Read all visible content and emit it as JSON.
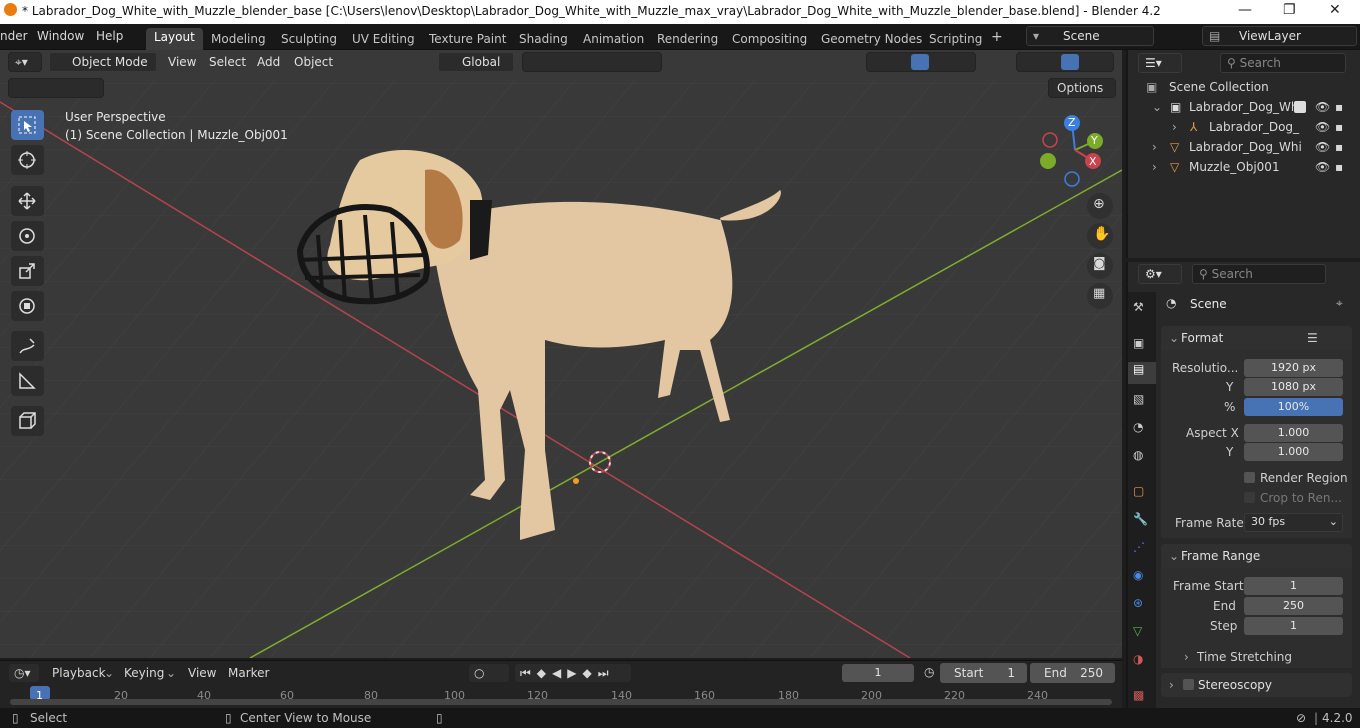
{
  "titlebar": {
    "title": "* Labrador_Dog_White_with_Muzzle_blender_base [C:\\Users\\lenov\\Desktop\\Labrador_Dog_White_with_Muzzle_max_vray\\Labrador_Dog_White_with_Muzzle_blender_base.blend] - Blender 4.2",
    "minimize": "—",
    "maximize": "❐",
    "close": "✕"
  },
  "menubar": {
    "items": [
      "nder",
      "Window",
      "Help"
    ]
  },
  "workspaces": {
    "tabs": [
      "Layout",
      "Modeling",
      "Sculpting",
      "UV Editing",
      "Texture Paint",
      "Shading",
      "Animation",
      "Rendering",
      "Compositing",
      "Geometry Nodes",
      "Scripting"
    ],
    "add": "+",
    "scene": "Scene",
    "view_layer": "ViewLayer"
  },
  "viewport_header": {
    "mode": "Object Mode",
    "menus": [
      "View",
      "Select",
      "Add",
      "Object"
    ],
    "orientation": "Global",
    "options": "Options"
  },
  "viewport": {
    "perspective": "User Perspective",
    "collection": "(1) Scene Collection | Muzzle_Obj001",
    "gizmo_labels": {
      "z": "Z",
      "y": "Y",
      "x": "X"
    },
    "colors": {
      "x_axis": "#c8434e",
      "y_axis": "#7cab2a",
      "z_axis": "#3b7fe0",
      "grid_bg": "#3a3a3a",
      "dog": "#e0c4a0",
      "muzzle": "#1a1a1a"
    }
  },
  "outliner": {
    "search_placeholder": "Search",
    "rows": [
      {
        "label": "Scene Collection"
      },
      {
        "label": "Labrador_Dog_Whi"
      },
      {
        "label": "Labrador_Dog_"
      },
      {
        "label": "Labrador_Dog_Whi"
      },
      {
        "label": "Muzzle_Obj001"
      }
    ]
  },
  "properties": {
    "search_placeholder": "Search",
    "context": "Scene",
    "format": {
      "title": "Format",
      "resolution_label": "Resolutio...",
      "res_x": "1920 px",
      "y_label": "Y",
      "res_y": "1080 px",
      "pct_label": "%",
      "pct": "100%",
      "aspect_label": "Aspect X",
      "aspect_x": "1.000",
      "aspect_y_label": "Y",
      "aspect_y": "1.000",
      "render_region": "Render Region",
      "crop": "Crop to Ren...",
      "frame_rate_label": "Frame Rate",
      "frame_rate": "30 fps"
    },
    "frame_range": {
      "title": "Frame Range",
      "start_label": "Frame Start",
      "start": "1",
      "end_label": "End",
      "end": "250",
      "step_label": "Step",
      "step": "1",
      "time_stretching": "Time Stretching"
    },
    "stereoscopy": "Stereoscopy"
  },
  "timeline": {
    "menus": [
      "Playback",
      "Keying",
      "View",
      "Marker"
    ],
    "current_frame": "1",
    "start_label": "Start",
    "start": "1",
    "end_label": "End",
    "end": "250",
    "ticks": [
      "1",
      "20",
      "40",
      "60",
      "80",
      "100",
      "120",
      "140",
      "160",
      "180",
      "200",
      "220",
      "240"
    ]
  },
  "statusbar": {
    "select": "Select",
    "center": "Center View to Mouse",
    "version": "4.2.0"
  }
}
